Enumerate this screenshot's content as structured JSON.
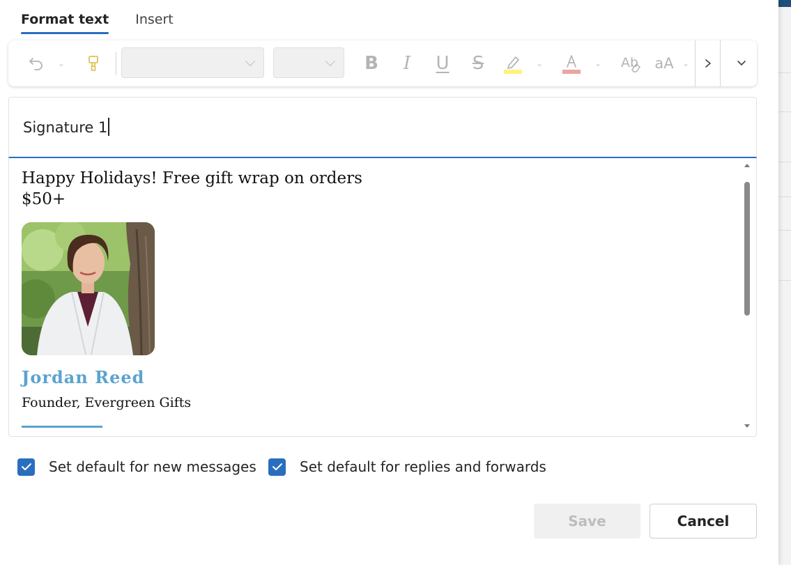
{
  "tabs": [
    {
      "label": "Format text",
      "active": true
    },
    {
      "label": "Insert",
      "active": false
    }
  ],
  "toolbar": {
    "undo_icon": "undo-icon",
    "format_painter_icon": "paintbrush-icon",
    "font_family_value": "",
    "font_size_value": "",
    "bold_label": "B",
    "italic_label": "I",
    "underline_label": "U",
    "strikethrough_label": "S",
    "highlight_color": "#fff27a",
    "font_color": "#e8a6a3",
    "change_case_label": "aA",
    "more_icon": "chevron-right-icon",
    "expand_icon": "chevron-down-icon"
  },
  "signature_name": {
    "value": "Signature 1"
  },
  "signature": {
    "line1": "Happy Holidays! Free gift wrap on orders",
    "line2": "$50+",
    "person_name": "Jordan Reed",
    "person_title": "Founder, Evergreen Gifts",
    "accent_color": "#5ba3cf"
  },
  "options": [
    {
      "label": "Set default for new messages",
      "checked": true
    },
    {
      "label": "Set default for replies and forwards",
      "checked": true
    }
  ],
  "actions": {
    "save_label": "Save",
    "cancel_label": "Cancel"
  },
  "colors": {
    "accent": "#2a6ebf"
  }
}
